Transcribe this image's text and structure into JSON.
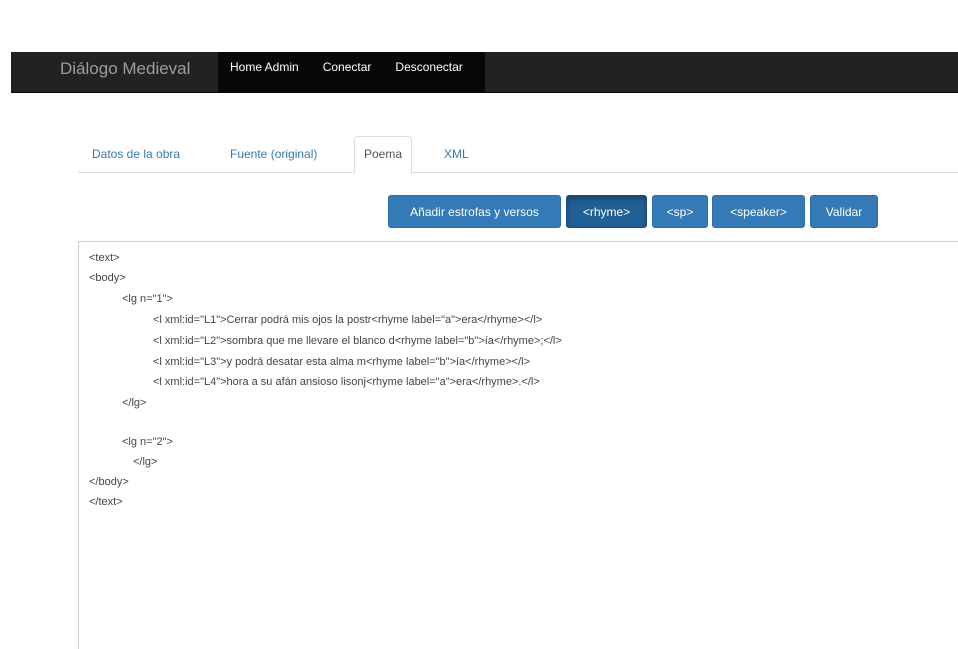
{
  "navbar": {
    "brand": "Diálogo Medieval",
    "links": [
      "Home Admin",
      "Conectar",
      "Desconectar"
    ]
  },
  "tabs": [
    {
      "label": "Datos de la obra",
      "active": false
    },
    {
      "label": "Fuente (original)",
      "active": false
    },
    {
      "label": "Poema",
      "active": true
    },
    {
      "label": "XML",
      "active": false
    }
  ],
  "toolbar": {
    "add_stanzas_label": "Añadir estrofas y versos",
    "rhyme_label": "<rhyme>",
    "sp_label": "<sp>",
    "speaker_label": "<speaker>",
    "validate_label": "Validar"
  },
  "editor": {
    "lines": [
      "<text>",
      "<body>",
      "<lg n=\"1\">",
      "<l xml:id=\"L1\">Cerrar podrá mis ojos la postr<rhyme label=\"a\">era</rhyme></l>",
      "<l xml:id=\"L2\">sombra que me llevare el blanco d<rhyme label=\"b\">ía</rhyme>;</l>",
      "<l xml:id=\"L3\">y podrá desatar esta alma m<rhyme label=\"b\">ía</rhyme></l>",
      "<l xml:id=\"L4\">hora a su afán ansioso lisonj<rhyme label=\"a\">era</rhyme>.</l>",
      "</lg>",
      "<lg n=\"2\">",
      "</lg>",
      "</body>",
      "</text>"
    ]
  },
  "colors": {
    "navbar_bg": "#222222",
    "primary": "#337ab7",
    "link": "#337ab7"
  }
}
